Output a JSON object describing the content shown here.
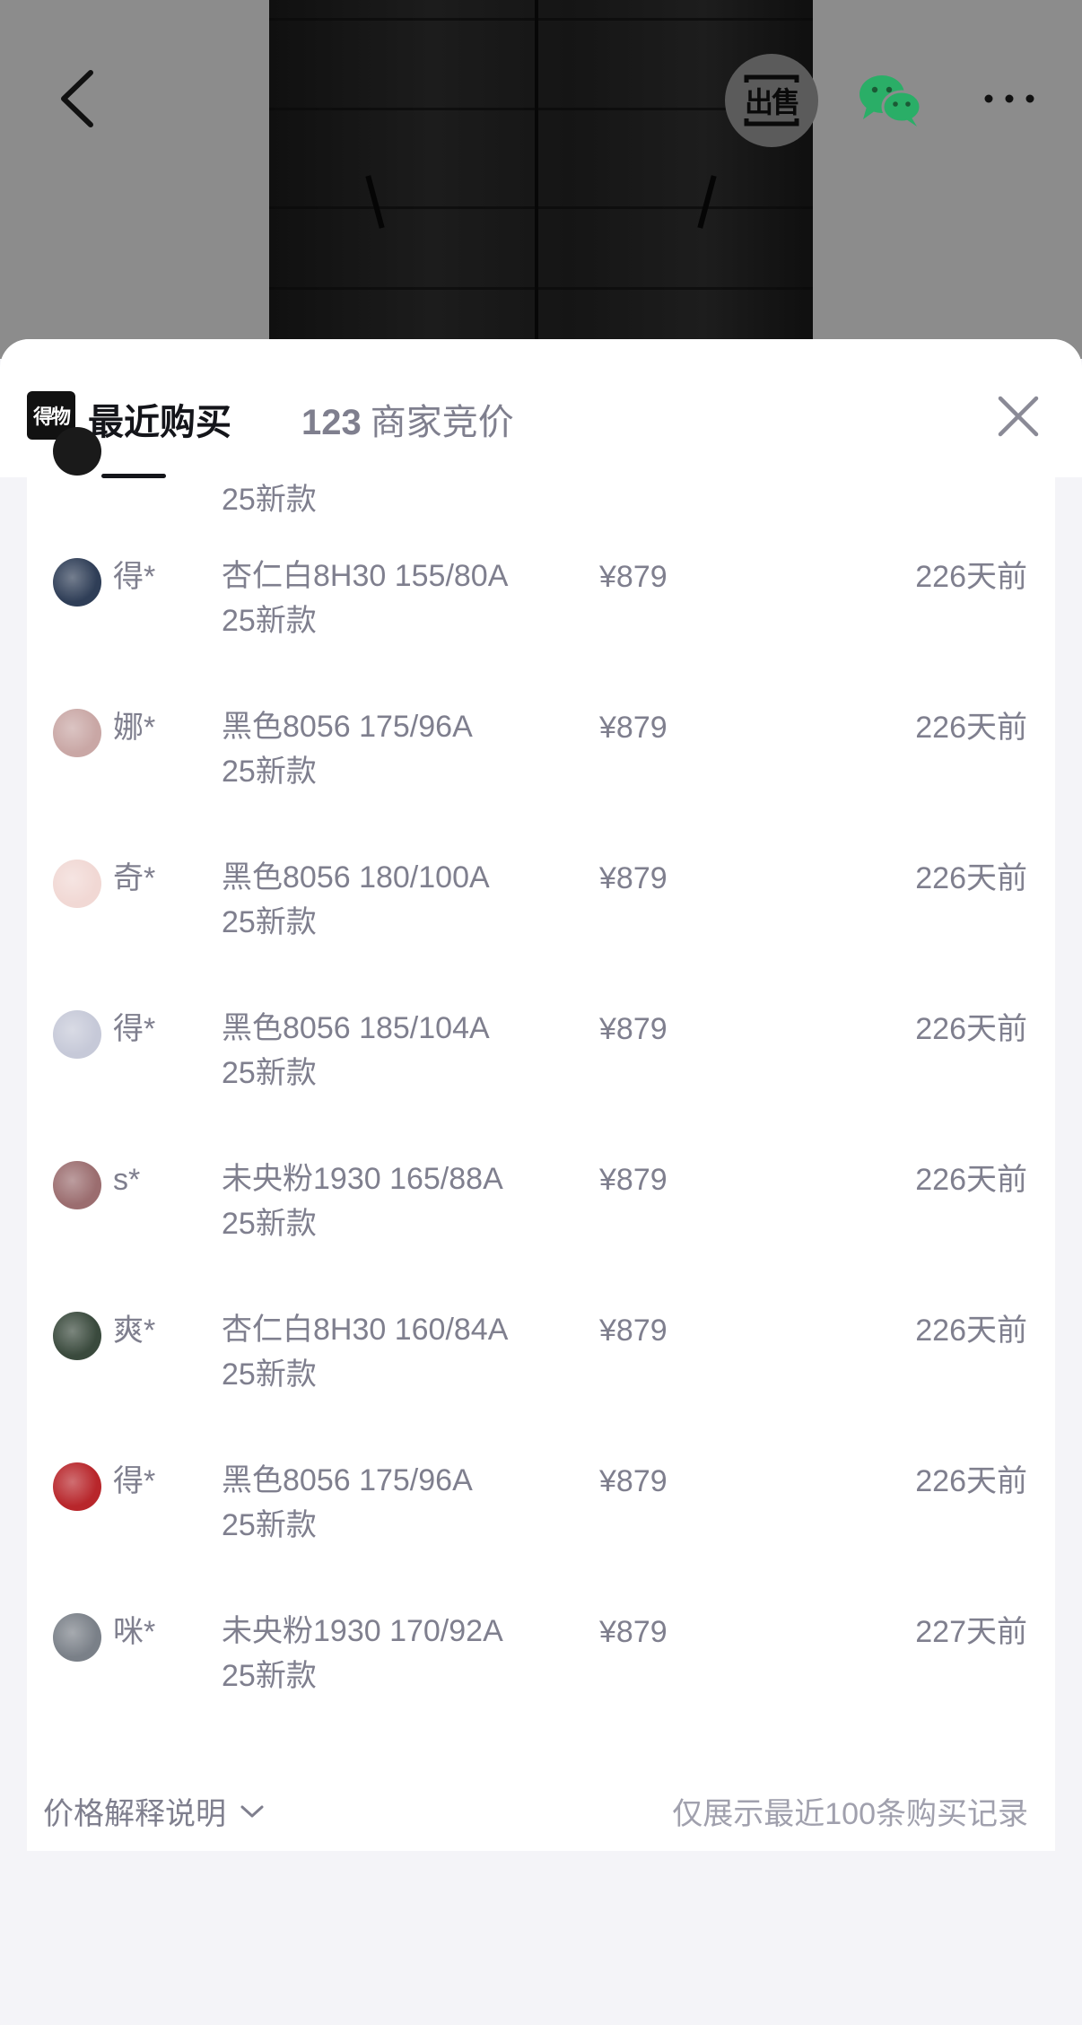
{
  "top_bar": {
    "sell_label": "出售",
    "icons": [
      "back-icon",
      "wechat-icon",
      "more-icon"
    ]
  },
  "sheet": {
    "logo_text": "得物",
    "tab_recent": "最近购买",
    "tab_bid_count": "123",
    "tab_bid_label": "商家竞价",
    "close_icon": "close-icon"
  },
  "partial_row": {
    "spec_line2": "25新款"
  },
  "purchases": [
    {
      "user": "得*",
      "spec": "杏仁白8H30 155/80A",
      "spec_line2": "25新款",
      "price": "¥879",
      "ago": "226天前",
      "avatar_color": "#2f3e57"
    },
    {
      "user": "娜*",
      "spec": "黑色8056 175/96A",
      "spec_line2": "25新款",
      "price": "¥879",
      "ago": "226天前",
      "avatar_color": "#c9a7a5"
    },
    {
      "user": "奇*",
      "spec": "黑色8056 180/100A",
      "spec_line2": "25新款",
      "price": "¥879",
      "ago": "226天前",
      "avatar_color": "#f1d8d4"
    },
    {
      "user": "得*",
      "spec": "黑色8056 185/104A",
      "spec_line2": "25新款",
      "price": "¥879",
      "ago": "226天前",
      "avatar_color": "#c6c9d8"
    },
    {
      "user": "s*",
      "spec": "未央粉1930 165/88A",
      "spec_line2": "25新款",
      "price": "¥879",
      "ago": "226天前",
      "avatar_color": "#9b6d6f"
    },
    {
      "user": "爽*",
      "spec": "杏仁白8H30 160/84A",
      "spec_line2": "25新款",
      "price": "¥879",
      "ago": "226天前",
      "avatar_color": "#3a4a3d"
    },
    {
      "user": "得*",
      "spec": "黑色8056 175/96A",
      "spec_line2": "25新款",
      "price": "¥879",
      "ago": "226天前",
      "avatar_color": "#b8262b"
    },
    {
      "user": "咪*",
      "spec": "未央粉1930 170/92A",
      "spec_line2": "25新款",
      "price": "¥879",
      "ago": "227天前",
      "avatar_color": "#7a8088"
    }
  ],
  "footer": {
    "price_explain": "价格解释说明",
    "note": "仅展示最近100条购买记录"
  },
  "colors": {
    "text_primary": "#14151a",
    "text_secondary": "#7f7f8e",
    "wechat_green": "#2aae67"
  }
}
